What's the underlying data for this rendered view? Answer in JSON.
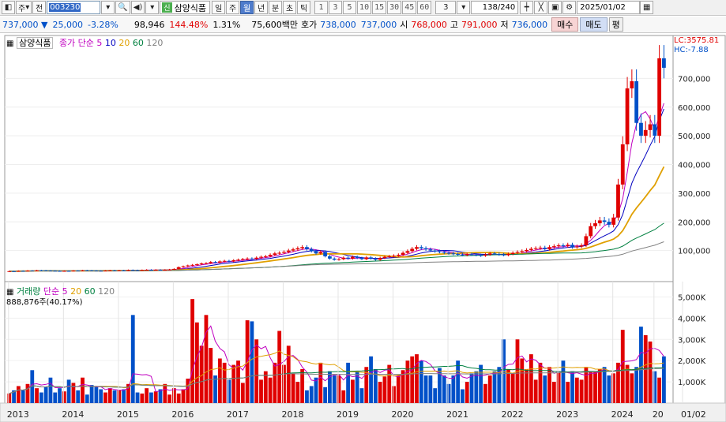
{
  "toolbar1": {
    "market_label": "주",
    "prev_label": "전",
    "code": "003230",
    "stock_badge": "신",
    "stock_name": "삼양식품",
    "periods": [
      "일",
      "주",
      "월",
      "년",
      "분",
      "초",
      "틱"
    ],
    "selected_period": "월",
    "intervals": [
      "1",
      "3",
      "5",
      "10",
      "15",
      "30",
      "45",
      "60"
    ],
    "interval_select": "3",
    "count_display": "138/240",
    "date": "2025/01/02"
  },
  "toolbar2": {
    "price": "737,000",
    "change_arrow": "▼",
    "change": "25,000",
    "change_pct": "-3.28%",
    "volume": "98,946",
    "vol_ratio": "144.48%",
    "turnover": "1.31%",
    "amount": "75,600백만",
    "hoga_label": "호가",
    "ask": "738,000",
    "bid": "737,000",
    "open_label": "시",
    "open": "768,000",
    "high_label": "고",
    "high": "791,000",
    "low_label": "저",
    "low": "736,000",
    "buy_label": "매수",
    "sell_label": "매도",
    "avg_label": "평"
  },
  "price_pane": {
    "name_tag": "삼양식품",
    "legend_title": "종가 단순",
    "ma": [
      "5",
      "10",
      "20",
      "60",
      "120"
    ],
    "ma_colors": [
      "#c000c0",
      "#0000c0",
      "#e0a000",
      "#008040",
      "#808080"
    ],
    "lc": "LC:3575.81",
    "hc": "HC:-7.88",
    "y_ticks": [
      "700,000",
      "600,000",
      "500,000",
      "400,000",
      "300,000",
      "200,000",
      "100,000"
    ]
  },
  "volume_pane": {
    "legend_title": "거래량",
    "legend_ma": "단순",
    "ma": [
      "5",
      "20",
      "60",
      "120"
    ],
    "current": "888,876주(40.17%)",
    "y_ticks": [
      "5,000K",
      "4,000K",
      "3,000K",
      "2,000K",
      "1,000K"
    ]
  },
  "x_axis": {
    "labels": [
      "2013",
      "2014",
      "2015",
      "2016",
      "2017",
      "2018",
      "2019",
      "2020",
      "2021",
      "2022",
      "2023",
      "2024",
      "20",
      "01/02"
    ]
  },
  "colors": {
    "up": "#e00000",
    "down": "#0050c8"
  },
  "chart_data": {
    "type": "candlestick",
    "interval": "monthly",
    "y_range": [
      0,
      800000
    ],
    "months_from": "2013-01",
    "candles_close": [
      28000,
      27500,
      29000,
      28500,
      30000,
      29500,
      31000,
      30500,
      30000,
      29500,
      29000,
      28500,
      29000,
      28500,
      30000,
      29500,
      31000,
      30500,
      30000,
      29500,
      29000,
      30000,
      31000,
      30000,
      31000,
      30500,
      32000,
      31500,
      31000,
      32000,
      33000,
      32500,
      33000,
      32000,
      33000,
      34000,
      36000,
      42000,
      45000,
      48000,
      50000,
      52000,
      55000,
      56000,
      60000,
      58000,
      62000,
      64000,
      62000,
      66000,
      68000,
      70000,
      72000,
      71000,
      75000,
      78000,
      80000,
      85000,
      90000,
      92000,
      95000,
      100000,
      104000,
      108000,
      112000,
      105000,
      98000,
      90000,
      95000,
      80000,
      72000,
      68000,
      70000,
      75000,
      72000,
      78000,
      74000,
      70000,
      76000,
      72000,
      68000,
      74000,
      78000,
      80000,
      82000,
      85000,
      92000,
      98000,
      106000,
      112000,
      108000,
      104000,
      100000,
      97000,
      95000,
      92000,
      90000,
      88000,
      86000,
      84000,
      87000,
      86000,
      84000,
      82000,
      86000,
      90000,
      88000,
      86000,
      84000,
      88000,
      92000,
      95000,
      98000,
      102000,
      106000,
      108000,
      110000,
      105000,
      112000,
      115000,
      118000,
      116000,
      120000,
      112000,
      114000,
      118000,
      150000,
      185000,
      195000,
      205000,
      200000,
      190000,
      215000,
      330000,
      470000,
      665000,
      690000,
      545000,
      500000,
      520000,
      540000,
      500000,
      770000,
      737000
    ],
    "volume_k": [
      450,
      600,
      800,
      600,
      900,
      1550,
      700,
      500,
      750,
      1200,
      500,
      700,
      550,
      1100,
      950,
      600,
      1200,
      400,
      850,
      750,
      650,
      500,
      700,
      600,
      600,
      650,
      900,
      4150,
      500,
      450,
      700,
      500,
      550,
      650,
      900,
      400,
      700,
      450,
      650,
      1150,
      4900,
      3800,
      2700,
      4150,
      2600,
      1300,
      2100,
      1900,
      1100,
      1800,
      2000,
      950,
      3900,
      3850,
      3000,
      1100,
      1500,
      1200,
      1900,
      3400,
      1800,
      2700,
      1400,
      1000,
      1600,
      600,
      800,
      1200,
      1900,
      750,
      1500,
      1300,
      1300,
      600,
      1900,
      1100,
      1500,
      700,
      1700,
      2200,
      1600,
      1000,
      1250,
      1800,
      800,
      1300,
      1550,
      2000,
      2200,
      2300,
      2000,
      1300,
      1300,
      700,
      1650,
      1300,
      900,
      1300,
      2000,
      650,
      1000,
      1400,
      1500,
      1800,
      900,
      1300,
      1500,
      1700,
      3000,
      1600,
      1400,
      3000,
      2100,
      1600,
      2300,
      1100,
      1900,
      1300,
      1700,
      1000,
      1450,
      2000,
      1000,
      1500,
      1200,
      1100,
      1700,
      1500,
      1500,
      1600,
      1700,
      1300,
      1400,
      1900,
      3450,
      1800,
      1400,
      1700,
      3600,
      3200,
      2900,
      1500,
      1200,
      2200
    ]
  }
}
